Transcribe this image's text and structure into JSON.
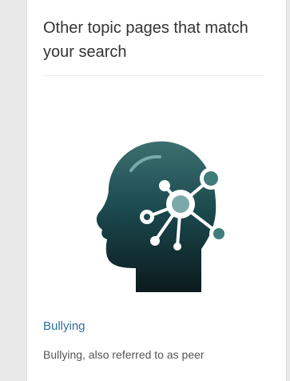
{
  "sidebar_card": {
    "title": "Other topic pages that match your search",
    "colors": {
      "title": "#333333",
      "link": "#2f6f9f",
      "icon_dark": "#163c40",
      "icon_light": "#7aa9a9",
      "node_dark": "#3f7c7b"
    },
    "topic": {
      "image_icon": "head-network-icon",
      "link_label": "Bullying",
      "snippet": "Bullying, also referred to as peer"
    }
  }
}
